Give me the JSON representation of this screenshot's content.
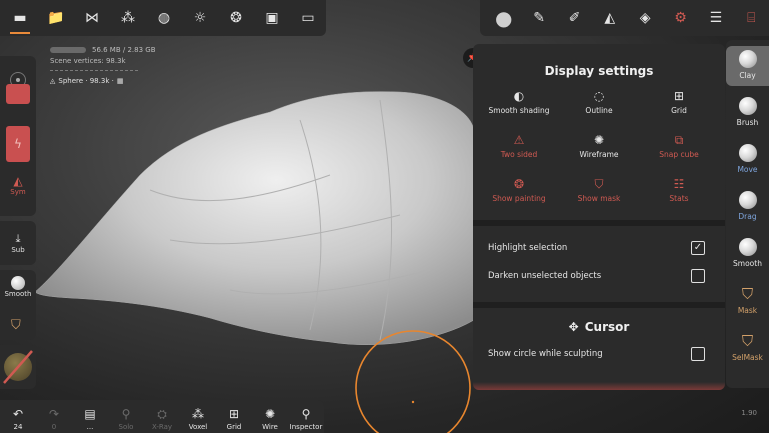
{
  "top_left_toolbar": {
    "buttons": [
      {
        "name": "scene-icon",
        "glyph": "▬"
      },
      {
        "name": "folder-icon",
        "glyph": "📁"
      },
      {
        "name": "share-nodes-icon",
        "glyph": "⋈"
      },
      {
        "name": "layers-tree-icon",
        "glyph": "⁂"
      },
      {
        "name": "sphere-grid-icon",
        "glyph": "◍"
      },
      {
        "name": "sun-icon",
        "glyph": "☼"
      },
      {
        "name": "aperture-icon",
        "glyph": "❂"
      },
      {
        "name": "image-icon",
        "glyph": "▣"
      },
      {
        "name": "video-camera-icon",
        "glyph": "▭"
      }
    ]
  },
  "top_right_toolbar": {
    "buttons": [
      {
        "name": "material-sphere-icon",
        "glyph": "●"
      },
      {
        "name": "brush-pen-icon",
        "glyph": "✎"
      },
      {
        "name": "eyedropper-icon",
        "glyph": "✐"
      },
      {
        "name": "symmetry-triangle-icon",
        "glyph": "◭"
      },
      {
        "name": "stack-layers-icon",
        "glyph": "◈"
      },
      {
        "name": "settings-gear-icon",
        "glyph": "⚙"
      },
      {
        "name": "sliders-icon",
        "glyph": "☰"
      },
      {
        "name": "history-stack-icon",
        "glyph": "⌸"
      }
    ],
    "accent": "#d05a52"
  },
  "stats": {
    "memory": "56.6 MB / 2.83 GB",
    "vertices": "Scene vertices: 98.3k",
    "object": "Sphere · 98.3k ·"
  },
  "left_column": {
    "sym_label": "Sym",
    "sub_label": "Sub",
    "smooth_label": "Smooth"
  },
  "bottom_bar": {
    "buttons": [
      {
        "name": "undo",
        "icon": "↶",
        "label": "24",
        "dim": false
      },
      {
        "name": "redo",
        "icon": "↷",
        "label": "0",
        "dim": true
      },
      {
        "name": "files",
        "icon": "▤",
        "label": "...",
        "dim": false
      },
      {
        "name": "solo",
        "icon": "⚲",
        "label": "Solo",
        "dim": true
      },
      {
        "name": "xray",
        "icon": "⛭",
        "label": "X-Ray",
        "dim": true
      },
      {
        "name": "voxel",
        "icon": "⁂",
        "label": "Voxel",
        "dim": false
      },
      {
        "name": "grid",
        "icon": "⊞",
        "label": "Grid",
        "dim": false
      },
      {
        "name": "wire",
        "icon": "✺",
        "label": "Wire",
        "dim": false
      },
      {
        "name": "inspector",
        "icon": "⚲",
        "label": "Inspector",
        "dim": false
      }
    ]
  },
  "display_settings": {
    "title": "Display settings",
    "options": [
      {
        "icon": "◐",
        "label": "Smooth shading",
        "red": false
      },
      {
        "icon": "◌",
        "label": "Outline",
        "red": false
      },
      {
        "icon": "⊞",
        "label": "Grid",
        "red": false
      },
      {
        "icon": "⚠",
        "label": "Two sided",
        "red": true
      },
      {
        "icon": "✺",
        "label": "Wireframe",
        "red": false
      },
      {
        "icon": "⧉",
        "label": "Snap cube",
        "red": true
      },
      {
        "icon": "❂",
        "label": "Show painting",
        "red": true
      },
      {
        "icon": "⛉",
        "label": "Show mask",
        "red": true
      },
      {
        "icon": "☷",
        "label": "Stats",
        "red": true
      }
    ],
    "highlight_selection": {
      "label": "Highlight selection",
      "checked": true
    },
    "darken_unselected": {
      "label": "Darken unselected objects",
      "checked": false
    },
    "cursor_title": "Cursor",
    "show_circle": {
      "label": "Show circle while sculpting",
      "checked": false
    }
  },
  "right_tools": [
    {
      "label": "Clay",
      "style": "normal",
      "active": true
    },
    {
      "label": "Brush",
      "style": "normal",
      "active": false
    },
    {
      "label": "Move",
      "style": "blue",
      "active": false
    },
    {
      "label": "Drag",
      "style": "blue",
      "active": false
    },
    {
      "label": "Smooth",
      "style": "normal",
      "active": false
    },
    {
      "label": "Mask",
      "style": "orange",
      "active": false
    },
    {
      "label": "SelMask",
      "style": "orange",
      "active": false
    }
  ],
  "version": "1.90"
}
